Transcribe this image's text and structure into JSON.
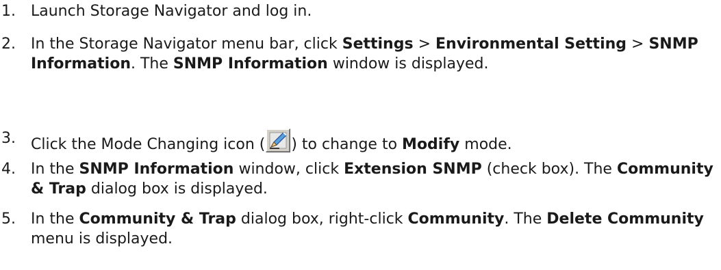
{
  "steps": [
    {
      "number": "1.",
      "segments": [
        {
          "t": "Launch Storage Navigator and log in.",
          "b": false
        }
      ]
    },
    {
      "number": "2.",
      "segments": [
        {
          "t": "In the Storage Navigator menu bar, click ",
          "b": false
        },
        {
          "t": "Settings",
          "b": true
        },
        {
          "t": " > ",
          "b": false
        },
        {
          "t": "Environmental Setting",
          "b": true
        },
        {
          "t": " > ",
          "b": false
        },
        {
          "t": "SNMP Information",
          "b": true
        },
        {
          "t": ". The ",
          "b": false
        },
        {
          "t": "SNMP Information",
          "b": true
        },
        {
          "t": " window is displayed.",
          "b": false
        }
      ]
    },
    {
      "number": "3.",
      "segments": [
        {
          "t": "Click the Mode Changing icon (",
          "b": false
        },
        {
          "icon": "mode-changing-icon"
        },
        {
          "t": ") to change to ",
          "b": false
        },
        {
          "t": "Modify",
          "b": true
        },
        {
          "t": " mode.",
          "b": false
        }
      ]
    },
    {
      "number": "4.",
      "segments": [
        {
          "t": "In the ",
          "b": false
        },
        {
          "t": "SNMP Information",
          "b": true
        },
        {
          "t": " window, click ",
          "b": false
        },
        {
          "t": "Extension SNMP",
          "b": true
        },
        {
          "t": " (check box). The ",
          "b": false
        },
        {
          "t": "Community & Trap",
          "b": true
        },
        {
          "t": " dialog box is displayed.",
          "b": false
        }
      ]
    },
    {
      "number": "5.",
      "segments": [
        {
          "t": "In the ",
          "b": false
        },
        {
          "t": "Community & Trap",
          "b": true
        },
        {
          "t": " dialog box, right-click ",
          "b": false
        },
        {
          "t": "Community",
          "b": true
        },
        {
          "t": ". The ",
          "b": false
        },
        {
          "t": "Delete Community",
          "b": true
        },
        {
          "t": " menu is displayed.",
          "b": false
        }
      ]
    }
  ]
}
